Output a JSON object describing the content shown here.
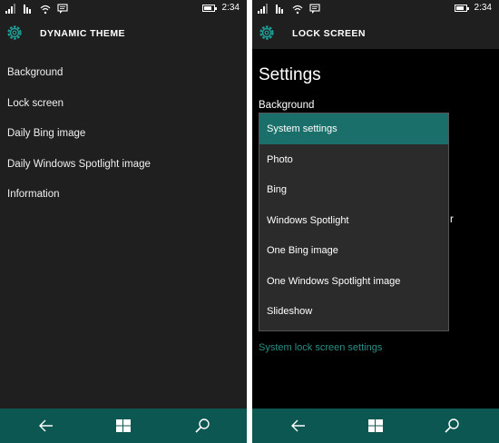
{
  "status": {
    "time": "2:34"
  },
  "left_phone": {
    "app_title": "DYNAMIC THEME",
    "nav_items": [
      "Background",
      "Lock screen",
      "Daily Bing image",
      "Daily Windows Spotlight image",
      "Information"
    ]
  },
  "right_phone": {
    "app_title": "LOCK SCREEN",
    "section_heading": "Settings",
    "background_label": "Background",
    "partial_text": "r",
    "dropdown": {
      "selected": "System settings",
      "options": [
        "System settings",
        "Photo",
        "Bing",
        "Windows Spotlight",
        "One Bing image",
        "One Windows Spotlight image",
        "Slideshow"
      ]
    },
    "system_link": "System lock screen settings"
  },
  "colors": {
    "accent": "#1b6f6a",
    "navbar": "#0d5752",
    "link": "#2a8f86",
    "left_background": "#1f1f1f",
    "right_background": "#000000"
  },
  "icons": {
    "status": [
      "signal-icon",
      "wifi-icon",
      "notification-icon",
      "message-icon",
      "battery-icon"
    ],
    "app": "settings-gear-icon",
    "navbar": [
      "back-icon",
      "windows-start-icon",
      "search-icon"
    ]
  }
}
